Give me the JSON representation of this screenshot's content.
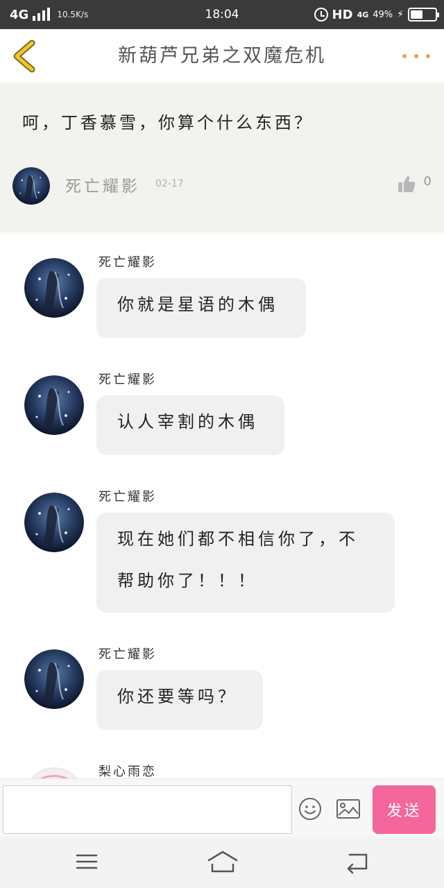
{
  "status_bar": {
    "network": "4G",
    "speed": "10.5K/s",
    "time": "18:04",
    "hd": "HD",
    "net2": "4G",
    "battery": "49%",
    "battery_level": 0.49
  },
  "header": {
    "title": "新葫芦兄弟之双魔危机"
  },
  "post": {
    "text": "呵，丁香慕雪，你算个什么东西？",
    "author": "死亡耀影",
    "date": "02-17",
    "likes": "0"
  },
  "messages": [
    {
      "author": "死亡耀影",
      "lines": [
        "你就是星语的木偶"
      ]
    },
    {
      "author": "死亡耀影",
      "lines": [
        "认人宰割的木偶"
      ]
    },
    {
      "author": "死亡耀影",
      "lines": [
        "现在她们都不相信你了，不",
        "帮助你了！！！"
      ]
    },
    {
      "author": "死亡耀影",
      "lines": [
        "你还要等吗？"
      ]
    },
    {
      "author": "梨心雨恋",
      "lines": []
    }
  ],
  "input": {
    "placeholder": "",
    "send_label": "发送"
  },
  "colors": {
    "accent": "#f4679d",
    "back_arrow": "#e8b820",
    "more_dots": "#f0a050",
    "post_bg": "#f2f2ee",
    "bubble_bg": "#f0f0f0"
  },
  "icons": {
    "back": "chevron-left-icon",
    "more": "more-dots-icon",
    "like": "thumbs-up-icon",
    "emoji": "emoji-icon",
    "image": "image-icon",
    "menu": "menu-icon",
    "home": "home-icon",
    "back_nav": "back-nav-icon"
  }
}
